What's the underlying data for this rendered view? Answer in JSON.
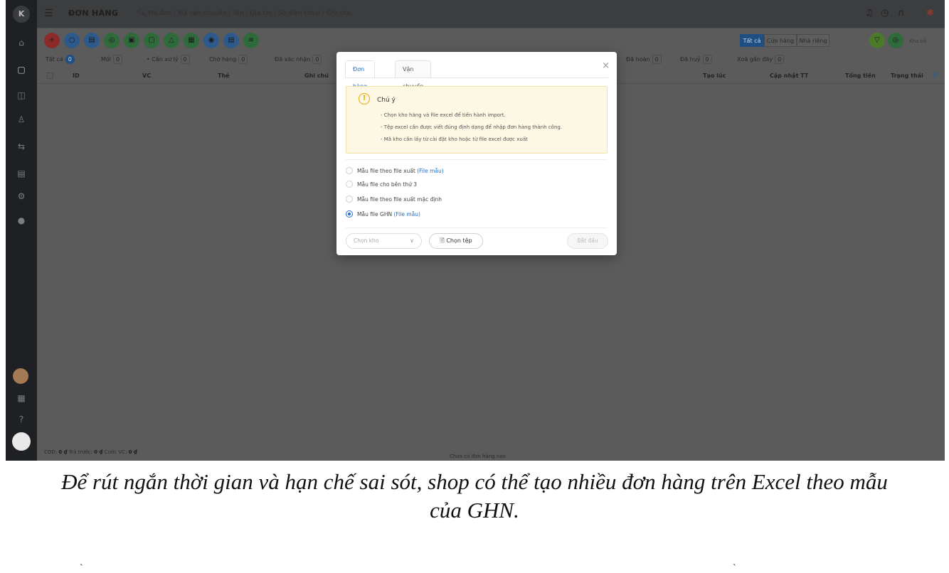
{
  "topbar": {
    "title": "ĐƠN HÀNG",
    "search_placeholder": "Mã đơn / Mã vận chuyển / Tên / Địa chỉ / Số điện thoại / Ghi chú"
  },
  "toolbar": {
    "segments": [
      "Tất cả",
      "Cửa hàng",
      "Nhà riêng"
    ],
    "right_text": "Kho bộ"
  },
  "filters": [
    {
      "label": "Tất cả",
      "count": "0"
    },
    {
      "label": "Mới",
      "count": "0"
    },
    {
      "label": "• Cần xử lý",
      "count": "0"
    },
    {
      "label": "Chờ hàng",
      "count": "0"
    },
    {
      "label": "Đã xác nhận",
      "count": "0"
    },
    {
      "label": "Đã hoàn",
      "count": "0"
    },
    {
      "label": "Đã huỷ",
      "count": "0"
    },
    {
      "label": "Xoá gần đây",
      "count": "0"
    }
  ],
  "table_headers": [
    "ID",
    "VC",
    "Thẻ",
    "Ghi chú",
    "Tạo lúc",
    "Cập nhật TT",
    "Tổng tiền",
    "Trạng thái"
  ],
  "footer": {
    "cod_label": "COD:",
    "cod_value": "0 ₫",
    "prepaid_label": "Trả trước:",
    "prepaid_value": "0 ₫",
    "fee_label": "Cước VC:",
    "fee_value": "0 ₫",
    "empty": "Chưa có đơn hàng nào"
  },
  "modal": {
    "tabs": [
      "Đơn hàng",
      "Vận chuyển"
    ],
    "close": "×",
    "alert": {
      "title": "Chú ý",
      "lines": [
        "- Chọn kho hàng và file excel để tiến hành import.",
        "- Tệp excel cần được viết đúng định dạng để nhập đơn hàng thành công.",
        "- Mã kho cần lấy từ cài đặt kho hoặc từ file excel được xuất"
      ]
    },
    "options": [
      {
        "label": "Mẫu file theo file xuất",
        "link": "(File mẫu)",
        "checked": false
      },
      {
        "label": "Mẫu file cho bên thứ 3",
        "link": "",
        "checked": false
      },
      {
        "label": "Mẫu file theo file xuất mặc định",
        "link": "",
        "checked": false
      },
      {
        "label": "Mẫu file GHN",
        "link": "(File mẫu)",
        "checked": true
      }
    ],
    "select_placeholder": "Chọn kho",
    "file_button": "Chọn tệp",
    "start_button": "Bắt đầu"
  },
  "caption": {
    "line1": "Để rút ngắn thời gian và hạn chế sai sót, shop có thể tạo nhiều đơn hàng trên Excel theo mẫu",
    "line2": "của GHN."
  }
}
